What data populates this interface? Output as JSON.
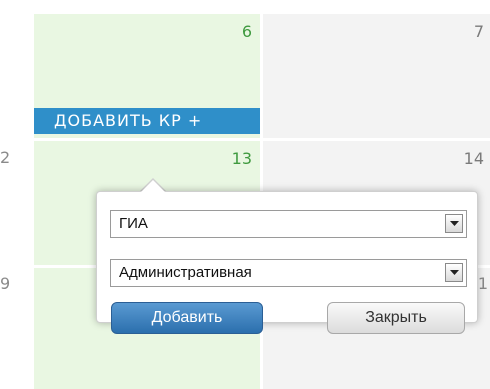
{
  "calendar": {
    "row1": {
      "green_day": "6",
      "gray_day": "7"
    },
    "row2": {
      "left_cut": "2",
      "green_day": "13",
      "gray_day": "14"
    },
    "row3": {
      "left_cut": "9",
      "right_cut": "1"
    },
    "add_kr_label": "ДОБАВИТЬ КР +"
  },
  "popup": {
    "select1": {
      "value": "ГИА"
    },
    "select2": {
      "value": "Административная"
    },
    "add_button": "Добавить",
    "close_button": "Закрыть"
  },
  "colors": {
    "green_cell": "#e9f7e2",
    "gray_cell": "#f3f3f3",
    "accent_bar": "#2f8fc9",
    "primary_button": "#2b6fad"
  }
}
